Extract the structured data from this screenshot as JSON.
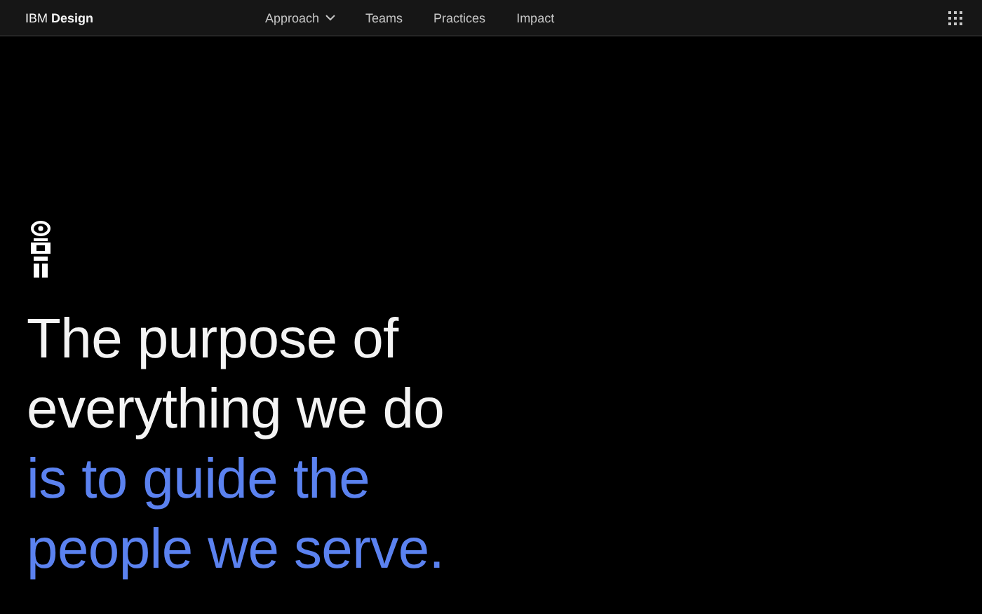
{
  "header": {
    "brand": "IBM **Design**",
    "nav": [
      {
        "label": "Approach",
        "dropdown": true
      },
      {
        "label": "Teams",
        "dropdown": false
      },
      {
        "label": "Practices",
        "dropdown": false
      },
      {
        "label": "Impact",
        "dropdown": false
      }
    ]
  },
  "headline": [
    {
      "text": "The purpose of",
      "accent": false
    },
    {
      "text": "everything we do",
      "accent": false
    },
    {
      "text": "is to guide the",
      "accent": true
    },
    {
      "text": "people we serve.",
      "accent": true
    }
  ]
}
